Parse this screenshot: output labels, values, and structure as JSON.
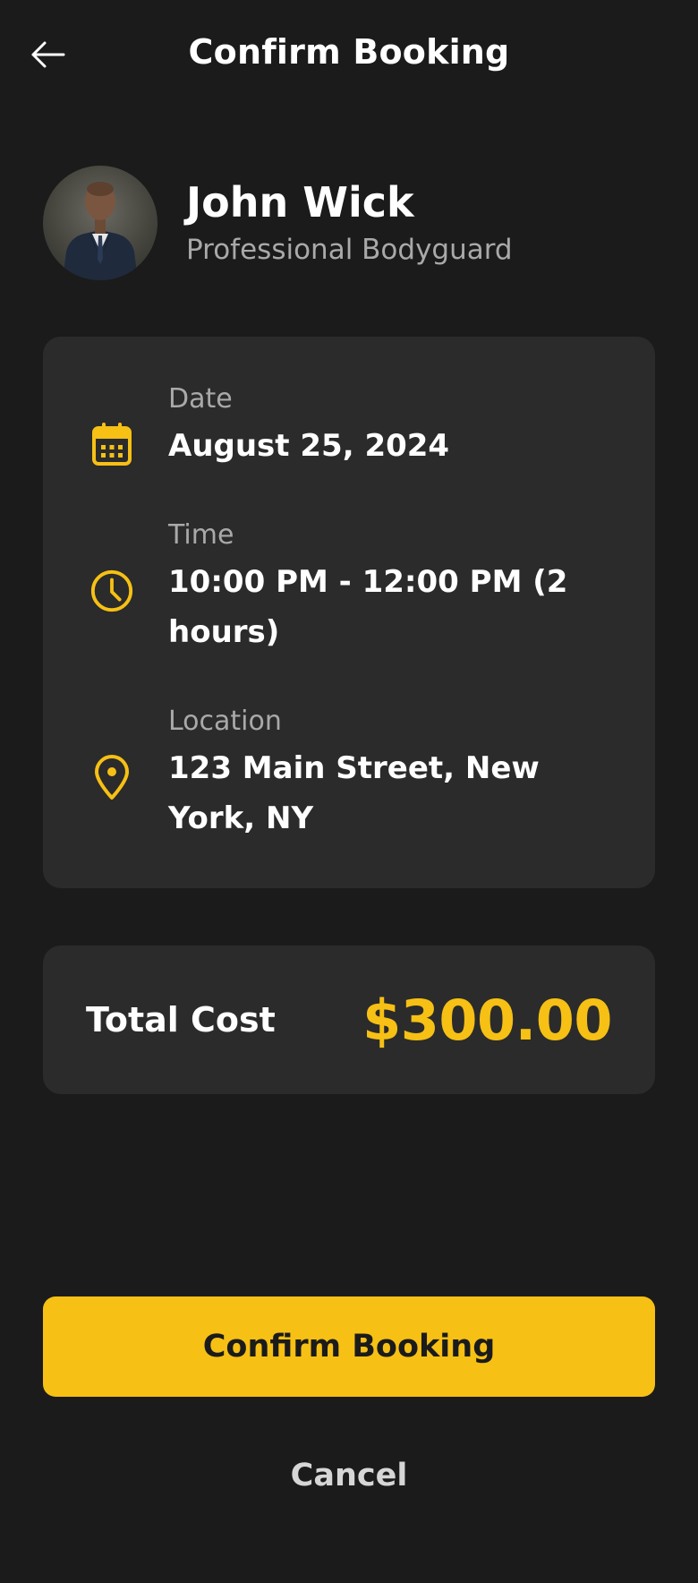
{
  "header": {
    "title": "Confirm Booking",
    "back_icon": "arrow-left-icon"
  },
  "profile": {
    "name": "John Wick",
    "role": "Professional Bodyguard"
  },
  "details": [
    {
      "label": "Date",
      "value": "August 25, 2024",
      "icon": "calendar-icon"
    },
    {
      "label": "Time",
      "value": "10:00 PM - 12:00 PM (2 hours)",
      "icon": "clock-icon"
    },
    {
      "label": "Location",
      "value": "123 Main Street, New York, NY",
      "icon": "map-pin-icon"
    }
  ],
  "cost": {
    "label": "Total Cost",
    "value": "$300.00"
  },
  "actions": {
    "confirm_label": "Confirm Booking",
    "cancel_label": "Cancel"
  },
  "colors": {
    "background": "#1b1b1b",
    "card": "#2b2b2b",
    "accent": "#f6c015",
    "muted_text": "#a9a9a9"
  }
}
